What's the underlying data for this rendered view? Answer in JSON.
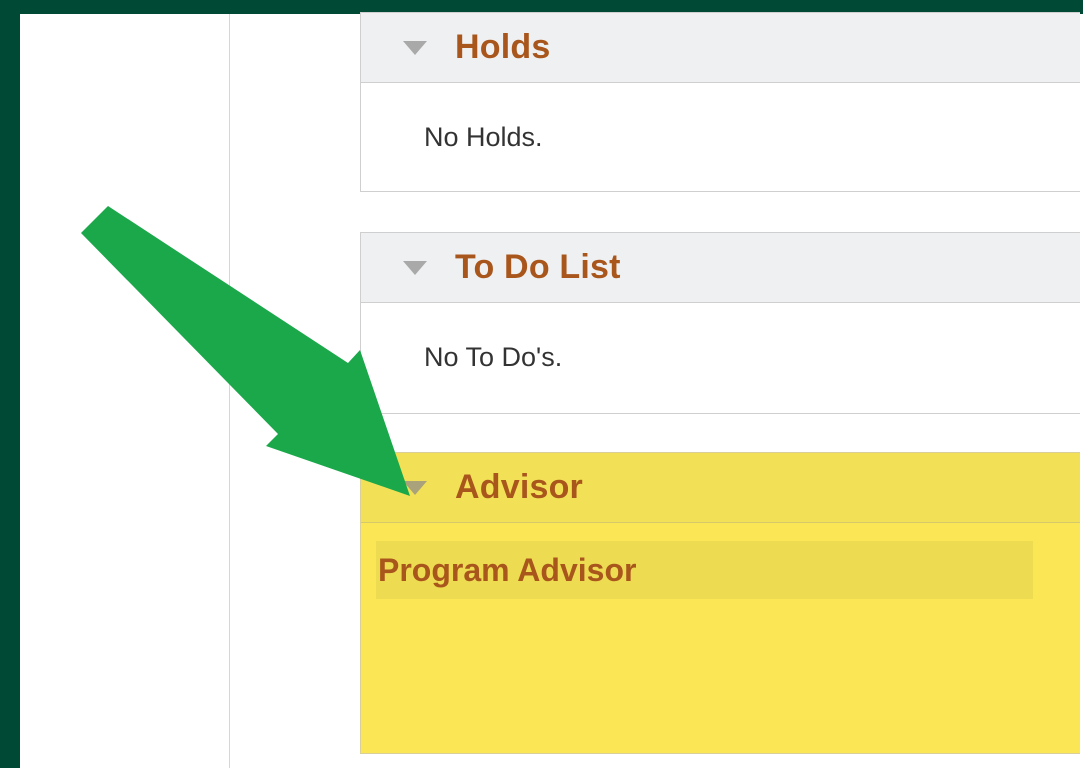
{
  "sections": {
    "holds": {
      "title": "Holds",
      "body": "No Holds."
    },
    "todo": {
      "title": "To Do List",
      "body": "No To Do's."
    },
    "advisor": {
      "title": "Advisor",
      "subheading": "Program Advisor"
    }
  },
  "colors": {
    "frame": "#004a35",
    "title_text": "#a9561c",
    "header_bg": "#eef0f1",
    "highlight": "#fbe655",
    "arrow": "#1aa84b"
  },
  "icons": {
    "collapse": "chevron-down-icon",
    "annotation": "arrow-pointer-icon"
  }
}
